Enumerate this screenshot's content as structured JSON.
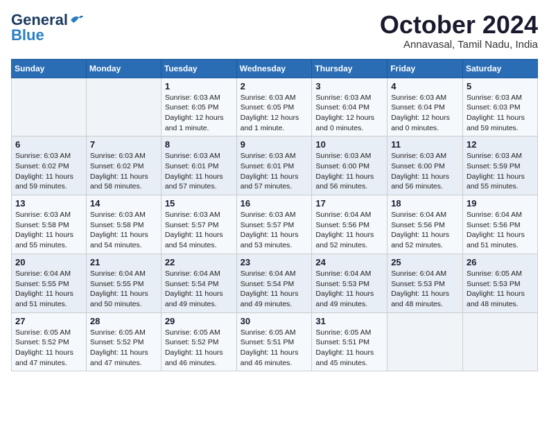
{
  "logo": {
    "general": "General",
    "blue": "Blue"
  },
  "header": {
    "month": "October 2024",
    "location": "Annavasal, Tamil Nadu, India"
  },
  "weekdays": [
    "Sunday",
    "Monday",
    "Tuesday",
    "Wednesday",
    "Thursday",
    "Friday",
    "Saturday"
  ],
  "weeks": [
    [
      {
        "day": "",
        "info": ""
      },
      {
        "day": "",
        "info": ""
      },
      {
        "day": "1",
        "info": "Sunrise: 6:03 AM\nSunset: 6:05 PM\nDaylight: 12 hours\nand 1 minute."
      },
      {
        "day": "2",
        "info": "Sunrise: 6:03 AM\nSunset: 6:05 PM\nDaylight: 12 hours\nand 1 minute."
      },
      {
        "day": "3",
        "info": "Sunrise: 6:03 AM\nSunset: 6:04 PM\nDaylight: 12 hours\nand 0 minutes."
      },
      {
        "day": "4",
        "info": "Sunrise: 6:03 AM\nSunset: 6:04 PM\nDaylight: 12 hours\nand 0 minutes."
      },
      {
        "day": "5",
        "info": "Sunrise: 6:03 AM\nSunset: 6:03 PM\nDaylight: 11 hours\nand 59 minutes."
      }
    ],
    [
      {
        "day": "6",
        "info": "Sunrise: 6:03 AM\nSunset: 6:02 PM\nDaylight: 11 hours\nand 59 minutes."
      },
      {
        "day": "7",
        "info": "Sunrise: 6:03 AM\nSunset: 6:02 PM\nDaylight: 11 hours\nand 58 minutes."
      },
      {
        "day": "8",
        "info": "Sunrise: 6:03 AM\nSunset: 6:01 PM\nDaylight: 11 hours\nand 57 minutes."
      },
      {
        "day": "9",
        "info": "Sunrise: 6:03 AM\nSunset: 6:01 PM\nDaylight: 11 hours\nand 57 minutes."
      },
      {
        "day": "10",
        "info": "Sunrise: 6:03 AM\nSunset: 6:00 PM\nDaylight: 11 hours\nand 56 minutes."
      },
      {
        "day": "11",
        "info": "Sunrise: 6:03 AM\nSunset: 6:00 PM\nDaylight: 11 hours\nand 56 minutes."
      },
      {
        "day": "12",
        "info": "Sunrise: 6:03 AM\nSunset: 5:59 PM\nDaylight: 11 hours\nand 55 minutes."
      }
    ],
    [
      {
        "day": "13",
        "info": "Sunrise: 6:03 AM\nSunset: 5:58 PM\nDaylight: 11 hours\nand 55 minutes."
      },
      {
        "day": "14",
        "info": "Sunrise: 6:03 AM\nSunset: 5:58 PM\nDaylight: 11 hours\nand 54 minutes."
      },
      {
        "day": "15",
        "info": "Sunrise: 6:03 AM\nSunset: 5:57 PM\nDaylight: 11 hours\nand 54 minutes."
      },
      {
        "day": "16",
        "info": "Sunrise: 6:03 AM\nSunset: 5:57 PM\nDaylight: 11 hours\nand 53 minutes."
      },
      {
        "day": "17",
        "info": "Sunrise: 6:04 AM\nSunset: 5:56 PM\nDaylight: 11 hours\nand 52 minutes."
      },
      {
        "day": "18",
        "info": "Sunrise: 6:04 AM\nSunset: 5:56 PM\nDaylight: 11 hours\nand 52 minutes."
      },
      {
        "day": "19",
        "info": "Sunrise: 6:04 AM\nSunset: 5:56 PM\nDaylight: 11 hours\nand 51 minutes."
      }
    ],
    [
      {
        "day": "20",
        "info": "Sunrise: 6:04 AM\nSunset: 5:55 PM\nDaylight: 11 hours\nand 51 minutes."
      },
      {
        "day": "21",
        "info": "Sunrise: 6:04 AM\nSunset: 5:55 PM\nDaylight: 11 hours\nand 50 minutes."
      },
      {
        "day": "22",
        "info": "Sunrise: 6:04 AM\nSunset: 5:54 PM\nDaylight: 11 hours\nand 49 minutes."
      },
      {
        "day": "23",
        "info": "Sunrise: 6:04 AM\nSunset: 5:54 PM\nDaylight: 11 hours\nand 49 minutes."
      },
      {
        "day": "24",
        "info": "Sunrise: 6:04 AM\nSunset: 5:53 PM\nDaylight: 11 hours\nand 49 minutes."
      },
      {
        "day": "25",
        "info": "Sunrise: 6:04 AM\nSunset: 5:53 PM\nDaylight: 11 hours\nand 48 minutes."
      },
      {
        "day": "26",
        "info": "Sunrise: 6:05 AM\nSunset: 5:53 PM\nDaylight: 11 hours\nand 48 minutes."
      }
    ],
    [
      {
        "day": "27",
        "info": "Sunrise: 6:05 AM\nSunset: 5:52 PM\nDaylight: 11 hours\nand 47 minutes."
      },
      {
        "day": "28",
        "info": "Sunrise: 6:05 AM\nSunset: 5:52 PM\nDaylight: 11 hours\nand 47 minutes."
      },
      {
        "day": "29",
        "info": "Sunrise: 6:05 AM\nSunset: 5:52 PM\nDaylight: 11 hours\nand 46 minutes."
      },
      {
        "day": "30",
        "info": "Sunrise: 6:05 AM\nSunset: 5:51 PM\nDaylight: 11 hours\nand 46 minutes."
      },
      {
        "day": "31",
        "info": "Sunrise: 6:05 AM\nSunset: 5:51 PM\nDaylight: 11 hours\nand 45 minutes."
      },
      {
        "day": "",
        "info": ""
      },
      {
        "day": "",
        "info": ""
      }
    ]
  ]
}
